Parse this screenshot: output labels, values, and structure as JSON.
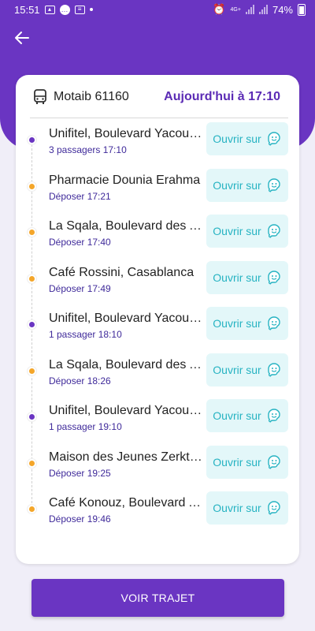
{
  "status_bar": {
    "time": "15:51",
    "battery": "74%",
    "network": "4G+"
  },
  "trip": {
    "vehicle": "Motaib 61160",
    "when": "Aujourd'hui à 17:10"
  },
  "open_label": "Ouvrir sur",
  "stops": [
    {
      "name": "Unifitel, Boulevard Yacoub El Mansour",
      "sub": "3 passagers 17:10",
      "type": "pickup"
    },
    {
      "name": "Pharmacie Dounia Erahma",
      "sub": "Déposer 17:21",
      "type": "dropoff"
    },
    {
      "name": "La Sqala, Boulevard des Almohades",
      "sub": "Déposer 17:40",
      "type": "dropoff"
    },
    {
      "name": "Café Rossini, Casablanca",
      "sub": "Déposer 17:49",
      "type": "dropoff"
    },
    {
      "name": "Unifitel, Boulevard Yacoub El Mansour",
      "sub": "1 passager 18:10",
      "type": "pickup"
    },
    {
      "name": "La Sqala, Boulevard des Almohades",
      "sub": "Déposer 18:26",
      "type": "dropoff"
    },
    {
      "name": "Unifitel, Boulevard Yacoub El Mansour",
      "sub": "1 passager 19:10",
      "type": "pickup"
    },
    {
      "name": "Maison des Jeunes Zerktouni",
      "sub": "Déposer 19:25",
      "type": "dropoff"
    },
    {
      "name": "Café Konouz, Boulevard Anfa",
      "sub": "Déposer 19:46",
      "type": "dropoff"
    }
  ],
  "cta_label": "VOIR TRAJET",
  "colors": {
    "primary": "#6a35c2",
    "pickup_dot": "#6a35c2",
    "dropoff_dot": "#f4a62a",
    "waze": "#26b3c2"
  }
}
